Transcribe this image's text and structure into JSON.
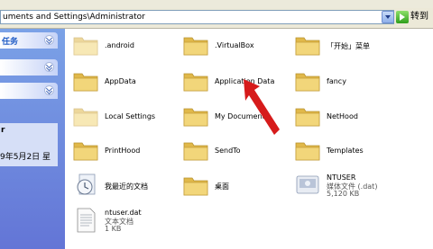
{
  "address": {
    "path": "uments and Settings\\Administrator",
    "go_label": "转到"
  },
  "sidebar": {
    "panels": [
      {
        "label": "任务"
      },
      {
        "label": ""
      },
      {
        "label": ""
      }
    ],
    "details": {
      "name": "r",
      "date": "9年5月2日 星"
    }
  },
  "files": [
    {
      "label": ".android",
      "type": "folder"
    },
    {
      "label": ".VirtualBox",
      "type": "folder"
    },
    {
      "label": "「开始」菜单",
      "type": "folder"
    },
    {
      "label": "AppData",
      "type": "folder"
    },
    {
      "label": "Application Data",
      "type": "folder"
    },
    {
      "label": "fancy",
      "type": "folder"
    },
    {
      "label": "Local Settings",
      "type": "folder"
    },
    {
      "label": "My Documents",
      "type": "folder"
    },
    {
      "label": "NetHood",
      "type": "folder"
    },
    {
      "label": "PrintHood",
      "type": "folder"
    },
    {
      "label": "SendTo",
      "type": "folder"
    },
    {
      "label": "Templates",
      "type": "folder"
    },
    {
      "label": "我最近的文档",
      "type": "recent"
    },
    {
      "label": "桌面",
      "type": "folder"
    },
    {
      "label": "NTUSER",
      "type": "file",
      "kind": "媒体文件 (.dat)",
      "size": "5,120 KB"
    },
    {
      "label": "ntuser.dat",
      "type": "file",
      "kind": "文本文档",
      "size": "1 KB"
    }
  ],
  "colors": {
    "folder": "#f2d67a",
    "sidebar_top": "#7ba2e7",
    "sidebar_bottom": "#6375d6",
    "arrow": "#d61b1b"
  }
}
